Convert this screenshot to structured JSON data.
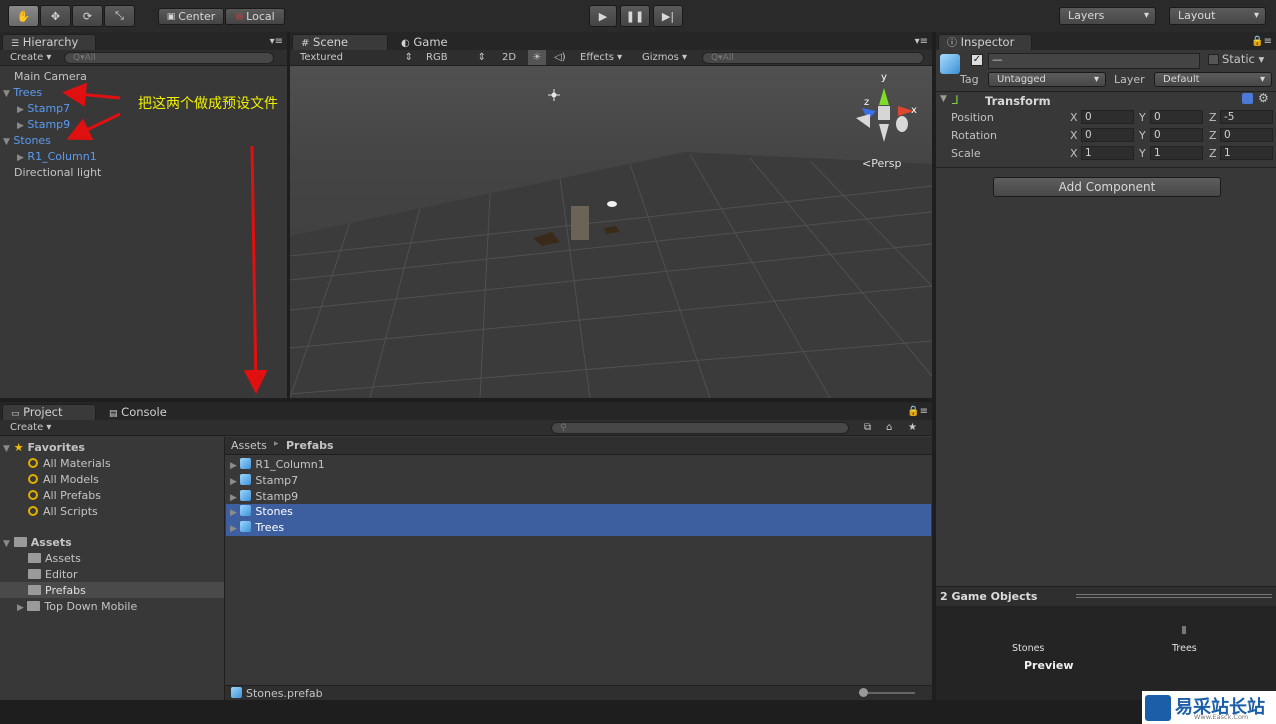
{
  "toolbar": {
    "pivot_label": "Center",
    "space_label": "Local",
    "layers_label": "Layers",
    "layout_label": "Layout"
  },
  "hierarchy": {
    "tab": "Hierarchy",
    "create": "Create",
    "search_placeholder": "Q▾All",
    "items": [
      "Main Camera",
      "Trees",
      "Stamp7",
      "Stamp9",
      "Stones",
      "R1_Column1",
      "Directional light"
    ],
    "annotation": "把这两个做成预设文件"
  },
  "scene": {
    "tab_scene": "Scene",
    "tab_game": "Game",
    "shading": "Textured",
    "render": "RGB",
    "mode_2d": "2D",
    "effects": "Effects",
    "gizmos": "Gizmos",
    "search_placeholder": "Q▾All",
    "persp_label": "Persp",
    "axis_y": "y",
    "axis_x": "x",
    "axis_z": "z"
  },
  "inspector": {
    "tab": "Inspector",
    "name_value": "—",
    "static_label": "Static",
    "tag_label": "Tag",
    "tag_value": "Untagged",
    "layer_label": "Layer",
    "layer_value": "Default",
    "transform_label": "Transform",
    "rows": [
      {
        "label": "Position",
        "x": "0",
        "y": "0",
        "z": "-5"
      },
      {
        "label": "Rotation",
        "x": "0",
        "y": "0",
        "z": "0"
      },
      {
        "label": "Scale",
        "x": "1",
        "y": "1",
        "z": "1"
      }
    ],
    "axis_x": "X",
    "axis_y": "Y",
    "axis_z": "Z",
    "add_component": "Add Component",
    "preview_title": "2 Game Objects",
    "preview_stones": "Stones",
    "preview_trees": "Trees",
    "preview_label": "Preview"
  },
  "project": {
    "tab_project": "Project",
    "tab_console": "Console",
    "create": "Create",
    "favorites_title": "Favorites",
    "favorites": [
      "All Materials",
      "All Models",
      "All Prefabs",
      "All Scripts"
    ],
    "assets_title": "Assets",
    "folders": [
      "Assets",
      "Editor",
      "Prefabs",
      "Top Down Mobile"
    ],
    "breadcrumb_root": "Assets",
    "breadcrumb_current": "Prefabs",
    "files": [
      "R1_Column1",
      "Stamp7",
      "Stamp9",
      "Stones",
      "Trees"
    ],
    "status_file": "Stones.prefab"
  },
  "watermark": {
    "text": "易采站长站",
    "url": "Www.Easck.Com"
  },
  "colors": {
    "selection": "#3d5f9f",
    "link_blue": "#5b9bf0",
    "arrow_red": "#e01010",
    "annotation_yellow": "#f0f000"
  }
}
